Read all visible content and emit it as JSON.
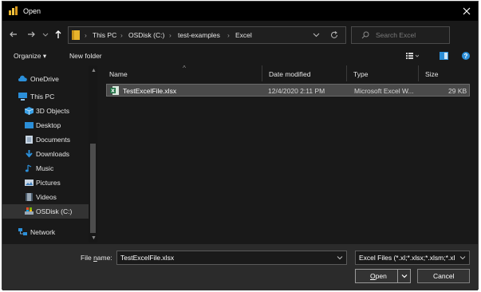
{
  "window": {
    "title": "Open"
  },
  "address": {
    "breadcrumbs": [
      "This PC",
      "OSDisk (C:)",
      "test-examples",
      "Excel"
    ]
  },
  "search": {
    "placeholder": "Search Excel"
  },
  "toolbar": {
    "organize_label": "Organize ▾",
    "new_folder_label": "New folder"
  },
  "nav": {
    "items": [
      {
        "label": "OneDrive",
        "icon": "cloud-icon"
      },
      {
        "label": "This PC",
        "icon": "computer-icon"
      },
      {
        "label": "3D Objects",
        "icon": "cube-icon"
      },
      {
        "label": "Desktop",
        "icon": "desktop-icon"
      },
      {
        "label": "Documents",
        "icon": "documents-icon"
      },
      {
        "label": "Downloads",
        "icon": "download-icon"
      },
      {
        "label": "Music",
        "icon": "music-icon"
      },
      {
        "label": "Pictures",
        "icon": "pictures-icon"
      },
      {
        "label": "Videos",
        "icon": "videos-icon"
      },
      {
        "label": "OSDisk (C:)",
        "icon": "drive-icon"
      },
      {
        "label": "Network",
        "icon": "network-icon"
      }
    ],
    "selected": "OSDisk (C:)"
  },
  "file_list": {
    "columns": [
      "Name",
      "Date modified",
      "Type",
      "Size"
    ],
    "rows": [
      {
        "name": "TestExcelFile.xlsx",
        "date": "12/4/2020 2:11 PM",
        "type": "Microsoft Excel W...",
        "size": "29 KB",
        "icon": "excel-file-icon"
      }
    ]
  },
  "bottom": {
    "filename_label_pre": "File ",
    "filename_label_n": "n",
    "filename_label_post": "ame:",
    "filename_value": "TestExcelFile.xlsx",
    "filetype_value": "Excel Files (*.xl;*.xlsx;*.xlsm;*.xl",
    "open_label_o": "O",
    "open_label_rest": "pen",
    "cancel_label": "Cancel"
  },
  "colors": {
    "accent": "#0078d7",
    "folder": "#e8b42c",
    "excel": "#1d6f42"
  }
}
